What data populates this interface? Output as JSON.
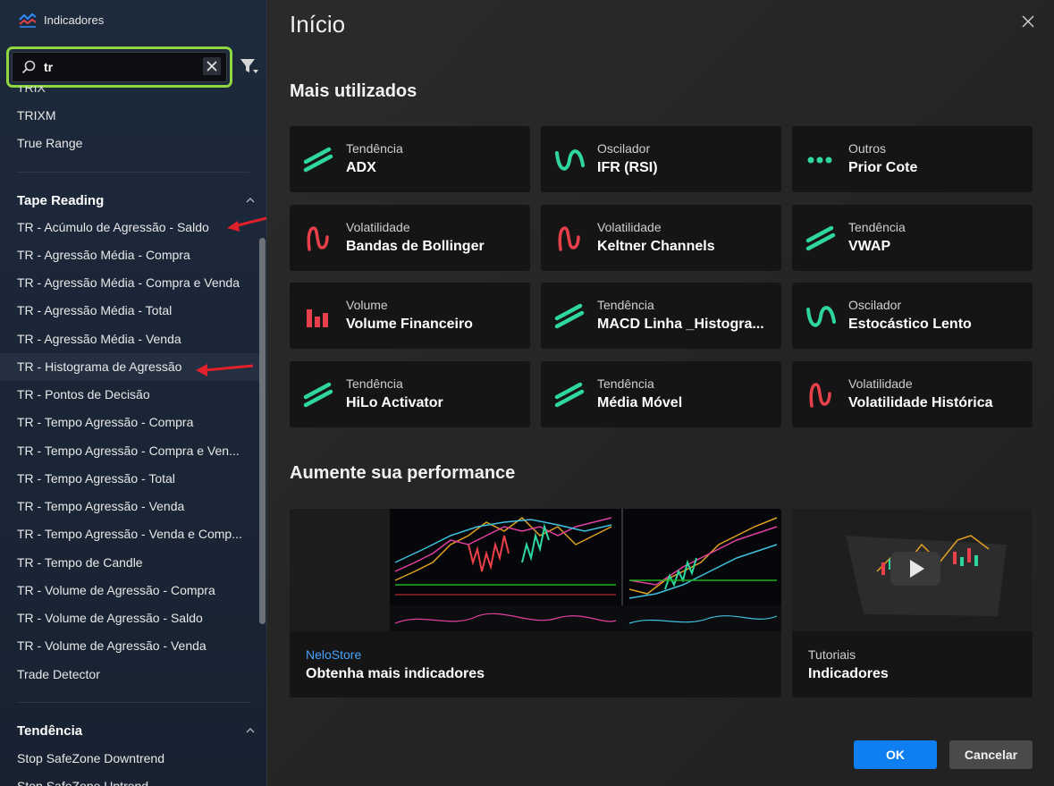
{
  "sidebar": {
    "window_title": "Indicadores",
    "search": {
      "value": "tr",
      "placeholder": ""
    },
    "items_top": [
      "TRIX",
      "TRIXM",
      "True Range"
    ],
    "groups": [
      {
        "title": "Tape Reading",
        "items": [
          "TR - Acúmulo de Agressão - Saldo",
          "TR - Agressão Média - Compra",
          "TR - Agressão Média - Compra e Venda",
          "TR - Agressão Média - Total",
          "TR - Agressão Média - Venda",
          "TR - Histograma de Agressão",
          "TR - Pontos de Decisão",
          "TR - Tempo Agressão - Compra",
          "TR - Tempo Agressão - Compra e Ven...",
          "TR - Tempo Agressão - Total",
          "TR - Tempo Agressão - Venda",
          "TR - Tempo Agressão - Venda e Comp...",
          "TR - Tempo de Candle",
          "TR - Volume de Agressão - Compra",
          "TR - Volume de Agressão - Saldo",
          "TR - Volume de Agressão - Venda",
          "Trade Detector"
        ]
      },
      {
        "title": "Tendência",
        "items": [
          "Stop SafeZone Downtrend",
          "Stop SafeZone Uptrend"
        ]
      }
    ]
  },
  "main": {
    "title": "Início",
    "most_used_title": "Mais utilizados",
    "cards": [
      {
        "category": "Tendência",
        "name": "ADX",
        "icon": "trend-icon"
      },
      {
        "category": "Oscilador",
        "name": "IFR (RSI)",
        "icon": "oscillator-icon"
      },
      {
        "category": "Outros",
        "name": "Prior Cote",
        "icon": "dots-icon"
      },
      {
        "category": "Volatilidade",
        "name": "Bandas de Bollinger",
        "icon": "volatility-icon"
      },
      {
        "category": "Volatilidade",
        "name": "Keltner Channels",
        "icon": "volatility-icon"
      },
      {
        "category": "Tendência",
        "name": "VWAP",
        "icon": "trend-icon"
      },
      {
        "category": "Volume",
        "name": "Volume Financeiro",
        "icon": "volume-icon"
      },
      {
        "category": "Tendência",
        "name": "MACD Linha _Histogra...",
        "icon": "trend-icon"
      },
      {
        "category": "Oscilador",
        "name": "Estocástico Lento",
        "icon": "oscillator-icon"
      },
      {
        "category": "Tendência",
        "name": "HiLo Activator",
        "icon": "trend-icon"
      },
      {
        "category": "Tendência",
        "name": "Média Móvel",
        "icon": "trend-icon"
      },
      {
        "category": "Volatilidade",
        "name": "Volatilidade Histórica",
        "icon": "volatility-icon"
      }
    ],
    "performance_title": "Aumente sua performance",
    "promos": [
      {
        "category": "NeloStore",
        "name": "Obtenha mais indicadores"
      },
      {
        "category": "Tutoriais",
        "name": "Indicadores"
      }
    ],
    "ok_label": "OK",
    "cancel_label": "Cancelar"
  },
  "colors": {
    "accent_green": "#2fd6a0",
    "accent_red": "#e8404a",
    "search_highlight": "#8fd641",
    "ok_blue": "#0f7ef0",
    "nelostore_link": "#4aa3ff"
  }
}
